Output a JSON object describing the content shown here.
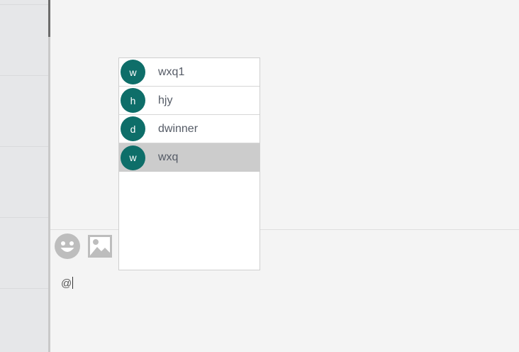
{
  "composer": {
    "input_value": "@",
    "tools": [
      {
        "icon": "emoji-icon"
      },
      {
        "icon": "image-icon"
      }
    ]
  },
  "mention_list": {
    "items": [
      {
        "initial": "w",
        "name": "wxq1",
        "selected": false
      },
      {
        "initial": "h",
        "name": "hjy",
        "selected": false
      },
      {
        "initial": "d",
        "name": "dwinner",
        "selected": false
      },
      {
        "initial": "w",
        "name": "wxq",
        "selected": true
      }
    ]
  },
  "colors": {
    "avatar_bg": "#0e6e69",
    "selected_bg": "#cccccc",
    "sidebar_bg": "#e6e7e9",
    "chat_bg": "#f4f4f4"
  }
}
